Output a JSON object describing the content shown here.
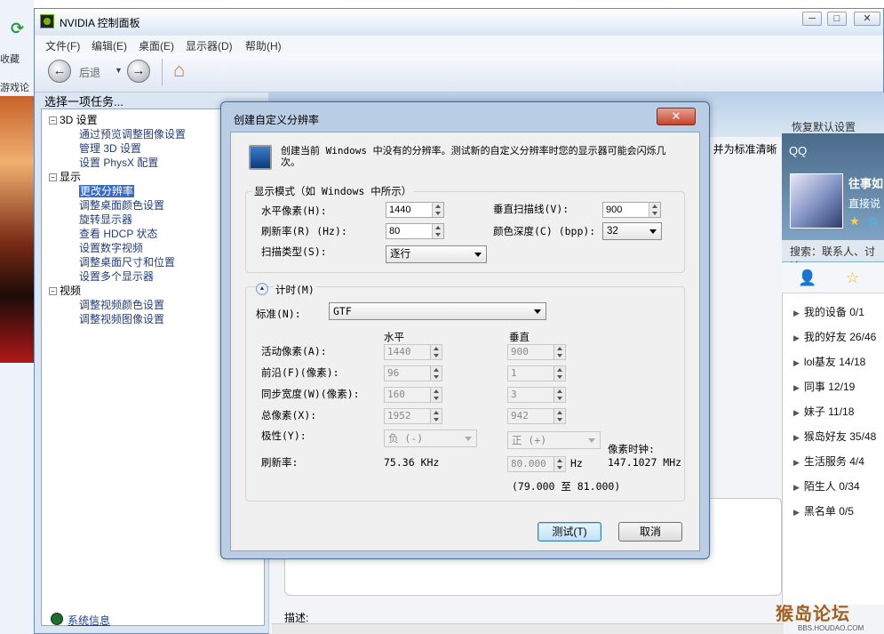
{
  "browser": {
    "fav_label": "收藏",
    "game_label": "游戏论"
  },
  "window": {
    "title": "NVIDIA 控制面板",
    "btn_min": "─",
    "btn_max": "□",
    "btn_close": "✕"
  },
  "menus": [
    "文件(F)",
    "编辑(E)",
    "桌面(E)",
    "显示器(D)",
    "帮助(H)"
  ],
  "toolbar": {
    "back_label": "后退"
  },
  "tasks": {
    "header": "选择一项任务...",
    "items": [
      {
        "label": "3D 设置",
        "level": 0,
        "toggle": "−"
      },
      {
        "label": "通过预览调整图像设置",
        "level": 1
      },
      {
        "label": "管理 3D 设置",
        "level": 1
      },
      {
        "label": "设置 PhysX 配置",
        "level": 1
      },
      {
        "label": "显示",
        "level": 0,
        "toggle": "−"
      },
      {
        "label": "更改分辨率",
        "level": 1,
        "selected": true
      },
      {
        "label": "调整桌面颜色设置",
        "level": 1
      },
      {
        "label": "旋转显示器",
        "level": 1
      },
      {
        "label": "查看 HDCP 状态",
        "level": 1
      },
      {
        "label": "设置数字视频",
        "level": 1
      },
      {
        "label": "调整桌面尺寸和位置",
        "level": 1
      },
      {
        "label": "设置多个显示器",
        "level": 1
      },
      {
        "label": "视频",
        "level": 0,
        "toggle": "−"
      },
      {
        "label": "调整视频颜色设置",
        "level": 1
      },
      {
        "label": "调整视频图像设置",
        "level": 1
      }
    ],
    "sysinfo": "系统信息"
  },
  "main": {
    "restore_defaults": "恢复默认设置",
    "desc_label": "描述:",
    "right_text": "), 并为标准清晰"
  },
  "dialog": {
    "title": "创建自定义分辨率",
    "close": "✕",
    "info": "创建当前 Windows 中没有的分辨率。测试新的自定义分辨率时您的显示器可能会闪烁几次。",
    "display_mode": {
      "group_label": "显示模式（如 Windows 中所示）",
      "h_pixels_label": "水平像素(H):",
      "h_pixels": "1440",
      "v_lines_label": "垂直扫描线(V):",
      "v_lines": "900",
      "refresh_label": "刷新率(R) (Hz):",
      "refresh": "80",
      "color_depth_label": "颜色深度(C) (bpp):",
      "color_depth": "32",
      "scan_type_label": "扫描类型(S):",
      "scan_type": "逐行"
    },
    "timing": {
      "label": "计时(M)",
      "standard_label": "标准(N):",
      "standard": "GTF",
      "col_h": "水平",
      "col_v": "垂直",
      "active_label": "活动像素(A):",
      "active_h": "1440",
      "active_v": "900",
      "front_label": "前沿(F)(像素):",
      "front_h": "96",
      "front_v": "1",
      "sync_label": "同步宽度(W)(像素):",
      "sync_h": "160",
      "sync_v": "3",
      "total_label": "总像素(X):",
      "total_h": "1952",
      "total_v": "942",
      "polarity_label": "极性(Y):",
      "polarity_h": "负 (-)",
      "polarity_v": "正 (+)",
      "refresh_label": "刷新率:",
      "refresh_h": "75.36 KHz",
      "refresh_v": "80.000",
      "refresh_v_unit": "Hz",
      "range": "(79.000 至 81.000)",
      "pixel_clock_label": "像素时钟:",
      "pixel_clock": "147.1027 MHz"
    },
    "test_button": "测试(T)",
    "cancel_button": "取消"
  },
  "qq": {
    "logo": "QQ",
    "name": "往事如",
    "status": "直接说",
    "search": "搜索：联系人、讨论",
    "groups": [
      {
        "label": "我的设备 0/1"
      },
      {
        "label": "我的好友 26/46"
      },
      {
        "label": "lol基友 14/18"
      },
      {
        "label": "同事 12/19"
      },
      {
        "label": "妹子 11/18"
      },
      {
        "label": "猴岛好友 35/48"
      },
      {
        "label": "生活服务 4/4"
      },
      {
        "label": "陌生人 0/34"
      },
      {
        "label": "黑名单 0/5"
      }
    ]
  },
  "watermark": {
    "title": "猴岛论坛",
    "sub": "BBS.HOUDAO.COM"
  }
}
